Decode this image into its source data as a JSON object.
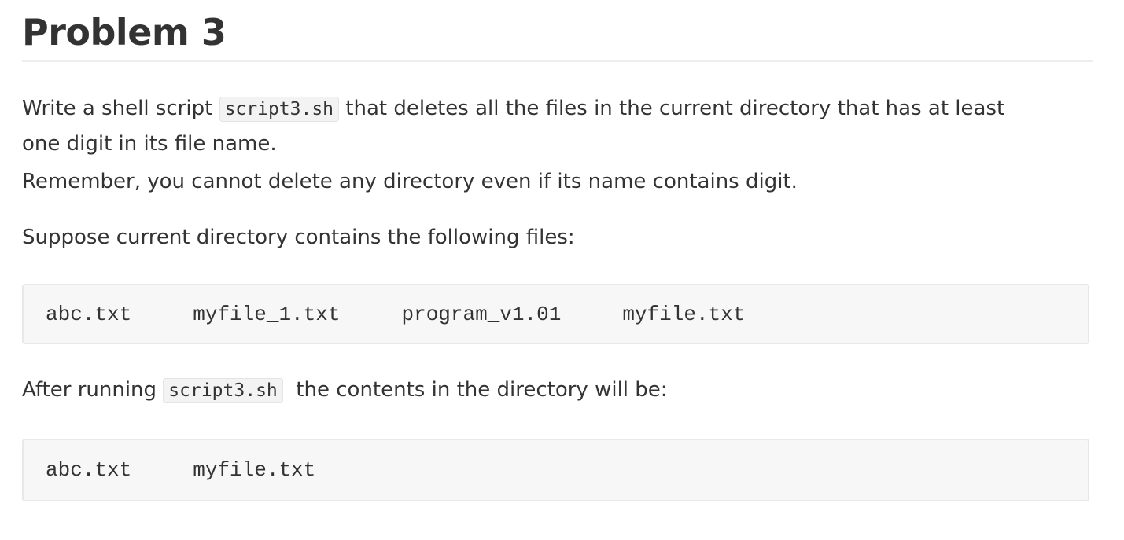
{
  "heading": "Problem 3",
  "paragraph1": {
    "before": "Write a shell script ",
    "code": "script3.sh",
    "after": " that deletes all the files in the current directory that has at least",
    "line2": "one digit in its file name.",
    "line3": "Remember, you cannot delete any directory even if its name contains digit."
  },
  "paragraph2": "Suppose current directory contains the following files:",
  "before_files": [
    "abc.txt",
    "myfile_1.txt",
    "program_v1.01",
    "myfile.txt"
  ],
  "paragraph3": {
    "before": "After running ",
    "code": "script3.sh",
    "after": "  the contents in the directory will be:"
  },
  "after_files": [
    "abc.txt",
    "myfile.txt"
  ]
}
